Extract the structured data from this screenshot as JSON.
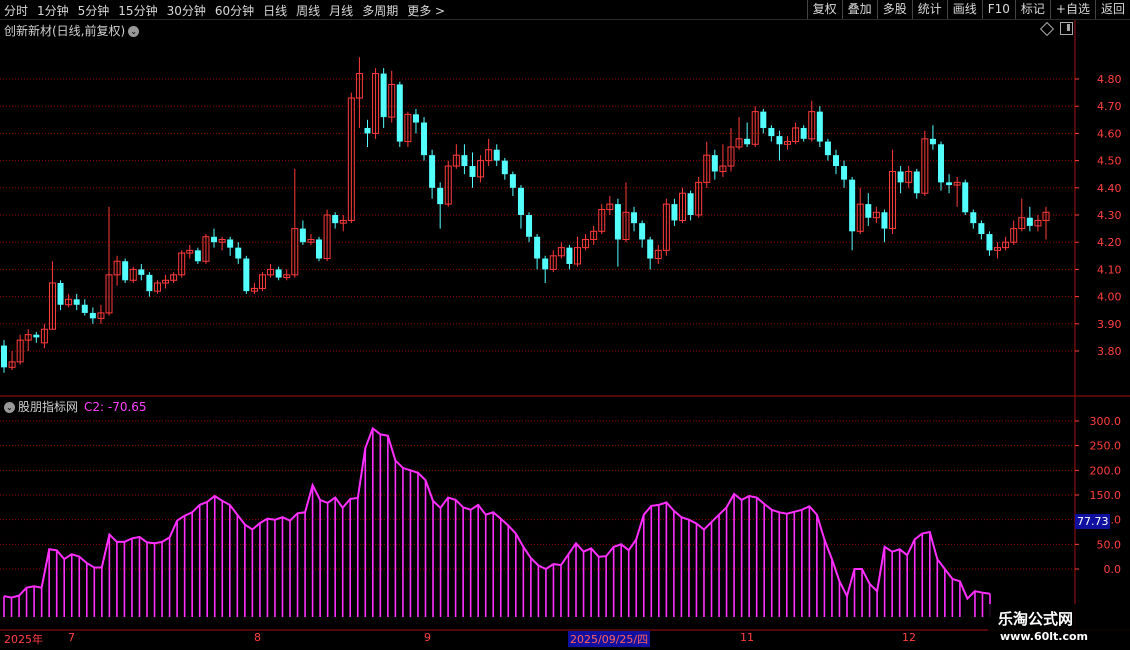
{
  "toolbar": {
    "left_items": [
      "分时",
      "1分钟",
      "5分钟",
      "15分钟",
      "30分钟",
      "60分钟",
      "日线",
      "周线",
      "月线",
      "多周期",
      "更多 >"
    ],
    "right_items": [
      "复权",
      "叠加",
      "多股",
      "统计",
      "画线",
      "F10",
      "标记",
      "+自选",
      "返回"
    ]
  },
  "stock": {
    "title": "创新新材(日线,前复权)"
  },
  "indicator": {
    "name": "股朋指标网",
    "c2_text": "C2: -70.65",
    "current_value": "77.73"
  },
  "watermark": {
    "line1": "乐淘公式网",
    "line2": "www.60lt.com"
  },
  "colors": {
    "up": "#ff3b3b",
    "down": "#54ffff",
    "indicator": "#ff30ff",
    "grid": "#8b0000",
    "axis": "#ff4040"
  },
  "x_axis_labels": [
    "2025年",
    "7",
    "8",
    "9",
    "2025/09/25/四",
    "11",
    "12"
  ],
  "chart_data": [
    {
      "type": "candlestick",
      "title": "创新新材(日线,前复权)",
      "y_ticks": [
        3.8,
        3.9,
        4.0,
        4.1,
        4.2,
        4.3,
        4.4,
        4.5,
        4.6,
        4.7,
        4.8
      ],
      "ylim": [
        3.7,
        4.9
      ],
      "candles": [
        [
          3.82,
          3.74,
          3.84,
          3.72
        ],
        [
          3.74,
          3.76,
          3.8,
          3.73
        ],
        [
          3.76,
          3.84,
          3.86,
          3.75
        ],
        [
          3.84,
          3.86,
          3.88,
          3.8
        ],
        [
          3.86,
          3.85,
          3.87,
          3.83
        ],
        [
          3.83,
          3.88,
          3.9,
          3.81
        ],
        [
          3.88,
          4.05,
          4.13,
          3.88
        ],
        [
          4.05,
          3.97,
          4.06,
          3.95
        ],
        [
          3.97,
          3.99,
          4.01,
          3.96
        ],
        [
          3.99,
          3.97,
          4.01,
          3.95
        ],
        [
          3.97,
          3.94,
          3.99,
          3.93
        ],
        [
          3.94,
          3.92,
          3.96,
          3.9
        ],
        [
          3.92,
          3.94,
          3.97,
          3.9
        ],
        [
          3.94,
          4.08,
          4.33,
          3.93
        ],
        [
          4.08,
          4.13,
          4.15,
          4.04
        ],
        [
          4.13,
          4.06,
          4.14,
          4.05
        ],
        [
          4.06,
          4.1,
          4.11,
          4.05
        ],
        [
          4.1,
          4.08,
          4.12,
          4.06
        ],
        [
          4.08,
          4.02,
          4.09,
          4.0
        ],
        [
          4.02,
          4.05,
          4.06,
          4.01
        ],
        [
          4.05,
          4.06,
          4.08,
          4.03
        ],
        [
          4.06,
          4.08,
          4.09,
          4.05
        ],
        [
          4.08,
          4.16,
          4.17,
          4.07
        ],
        [
          4.16,
          4.17,
          4.19,
          4.14
        ],
        [
          4.17,
          4.13,
          4.18,
          4.12
        ],
        [
          4.13,
          4.22,
          4.23,
          4.12
        ],
        [
          4.22,
          4.2,
          4.25,
          4.18
        ],
        [
          4.2,
          4.21,
          4.22,
          4.17
        ],
        [
          4.21,
          4.18,
          4.22,
          4.15
        ],
        [
          4.18,
          4.14,
          4.2,
          4.12
        ],
        [
          4.14,
          4.02,
          4.15,
          4.01
        ],
        [
          4.02,
          4.03,
          4.05,
          4.01
        ],
        [
          4.03,
          4.08,
          4.09,
          4.02
        ],
        [
          4.08,
          4.1,
          4.12,
          4.07
        ],
        [
          4.1,
          4.07,
          4.11,
          4.06
        ],
        [
          4.07,
          4.08,
          4.1,
          4.06
        ],
        [
          4.08,
          4.25,
          4.47,
          4.07
        ],
        [
          4.25,
          4.2,
          4.28,
          4.19
        ],
        [
          4.2,
          4.21,
          4.23,
          4.19
        ],
        [
          4.21,
          4.14,
          4.22,
          4.13
        ],
        [
          4.14,
          4.3,
          4.32,
          4.13
        ],
        [
          4.3,
          4.27,
          4.31,
          4.25
        ],
        [
          4.27,
          4.28,
          4.3,
          4.24
        ],
        [
          4.28,
          4.73,
          4.75,
          4.27
        ],
        [
          4.73,
          4.82,
          4.88,
          4.62
        ],
        [
          4.62,
          4.6,
          4.65,
          4.55
        ],
        [
          4.6,
          4.82,
          4.84,
          4.58
        ],
        [
          4.82,
          4.66,
          4.84,
          4.62
        ],
        [
          4.66,
          4.78,
          4.83,
          4.64
        ],
        [
          4.78,
          4.57,
          4.79,
          4.55
        ],
        [
          4.57,
          4.67,
          4.68,
          4.55
        ],
        [
          4.67,
          4.64,
          4.69,
          4.6
        ],
        [
          4.64,
          4.52,
          4.66,
          4.5
        ],
        [
          4.52,
          4.4,
          4.54,
          4.36
        ],
        [
          4.4,
          4.34,
          4.42,
          4.25
        ],
        [
          4.34,
          4.48,
          4.5,
          4.33
        ],
        [
          4.48,
          4.52,
          4.56,
          4.47
        ],
        [
          4.52,
          4.48,
          4.56,
          4.45
        ],
        [
          4.48,
          4.44,
          4.53,
          4.4
        ],
        [
          4.44,
          4.5,
          4.52,
          4.42
        ],
        [
          4.5,
          4.54,
          4.58,
          4.48
        ],
        [
          4.54,
          4.5,
          4.56,
          4.48
        ],
        [
          4.5,
          4.45,
          4.51,
          4.43
        ],
        [
          4.45,
          4.4,
          4.46,
          4.37
        ],
        [
          4.4,
          4.3,
          4.41,
          4.25
        ],
        [
          4.3,
          4.22,
          4.31,
          4.2
        ],
        [
          4.22,
          4.14,
          4.23,
          4.1
        ],
        [
          4.14,
          4.1,
          4.15,
          4.05
        ],
        [
          4.1,
          4.15,
          4.17,
          4.09
        ],
        [
          4.15,
          4.18,
          4.2,
          4.14
        ],
        [
          4.18,
          4.12,
          4.19,
          4.1
        ],
        [
          4.12,
          4.18,
          4.22,
          4.11
        ],
        [
          4.18,
          4.21,
          4.23,
          4.17
        ],
        [
          4.21,
          4.24,
          4.26,
          4.19
        ],
        [
          4.24,
          4.32,
          4.34,
          4.23
        ],
        [
          4.32,
          4.34,
          4.37,
          4.3
        ],
        [
          4.34,
          4.21,
          4.36,
          4.11
        ],
        [
          4.21,
          4.31,
          4.42,
          4.2
        ],
        [
          4.31,
          4.27,
          4.33,
          4.24
        ],
        [
          4.27,
          4.21,
          4.28,
          4.18
        ],
        [
          4.21,
          4.14,
          4.22,
          4.1
        ],
        [
          4.14,
          4.17,
          4.19,
          4.12
        ],
        [
          4.17,
          4.34,
          4.36,
          4.15
        ],
        [
          4.34,
          4.28,
          4.36,
          4.26
        ],
        [
          4.28,
          4.38,
          4.4,
          4.27
        ],
        [
          4.38,
          4.3,
          4.39,
          4.28
        ],
        [
          4.3,
          4.42,
          4.44,
          4.29
        ],
        [
          4.42,
          4.52,
          4.57,
          4.4
        ],
        [
          4.52,
          4.46,
          4.54,
          4.43
        ],
        [
          4.46,
          4.48,
          4.56,
          4.44
        ],
        [
          4.48,
          4.55,
          4.62,
          4.46
        ],
        [
          4.55,
          4.58,
          4.66,
          4.54
        ],
        [
          4.58,
          4.56,
          4.64,
          4.55
        ],
        [
          4.56,
          4.68,
          4.7,
          4.55
        ],
        [
          4.68,
          4.62,
          4.69,
          4.6
        ],
        [
          4.62,
          4.59,
          4.63,
          4.57
        ],
        [
          4.59,
          4.56,
          4.61,
          4.5
        ],
        [
          4.56,
          4.57,
          4.59,
          4.54
        ],
        [
          4.57,
          4.62,
          4.64,
          4.56
        ],
        [
          4.62,
          4.58,
          4.63,
          4.57
        ],
        [
          4.58,
          4.68,
          4.72,
          4.57
        ],
        [
          4.68,
          4.57,
          4.7,
          4.55
        ],
        [
          4.57,
          4.52,
          4.58,
          4.5
        ],
        [
          4.52,
          4.48,
          4.54,
          4.45
        ],
        [
          4.48,
          4.43,
          4.5,
          4.4
        ],
        [
          4.43,
          4.24,
          4.44,
          4.17
        ],
        [
          4.24,
          4.34,
          4.4,
          4.23
        ],
        [
          4.34,
          4.29,
          4.38,
          4.26
        ],
        [
          4.29,
          4.31,
          4.33,
          4.27
        ],
        [
          4.31,
          4.25,
          4.32,
          4.2
        ],
        [
          4.25,
          4.46,
          4.54,
          4.23
        ],
        [
          4.46,
          4.42,
          4.48,
          4.38
        ],
        [
          4.42,
          4.46,
          4.48,
          4.4
        ],
        [
          4.46,
          4.38,
          4.47,
          4.36
        ],
        [
          4.38,
          4.58,
          4.61,
          4.37
        ],
        [
          4.58,
          4.56,
          4.63,
          4.54
        ],
        [
          4.56,
          4.42,
          4.57,
          4.39
        ],
        [
          4.42,
          4.41,
          4.45,
          4.38
        ],
        [
          4.41,
          4.42,
          4.44,
          4.33
        ],
        [
          4.42,
          4.31,
          4.43,
          4.3
        ],
        [
          4.31,
          4.27,
          4.32,
          4.25
        ],
        [
          4.27,
          4.23,
          4.28,
          4.21
        ],
        [
          4.23,
          4.17,
          4.24,
          4.15
        ],
        [
          4.17,
          4.18,
          4.2,
          4.14
        ],
        [
          4.18,
          4.2,
          4.22,
          4.17
        ],
        [
          4.2,
          4.25,
          4.28,
          4.19
        ],
        [
          4.25,
          4.29,
          4.36,
          4.24
        ],
        [
          4.29,
          4.26,
          4.33,
          4.24
        ],
        [
          4.26,
          4.28,
          4.3,
          4.24
        ],
        [
          4.28,
          4.31,
          4.33,
          4.21
        ]
      ]
    },
    {
      "type": "bar",
      "title": "股朋指标网",
      "y_ticks": [
        0,
        50,
        100,
        150,
        200,
        250,
        300
      ],
      "ylim": [
        -60,
        330
      ],
      "values": [
        -55,
        -58,
        -54,
        -38,
        -35,
        -38,
        40,
        38,
        20,
        30,
        25,
        12,
        3,
        3,
        70,
        55,
        55,
        62,
        65,
        54,
        52,
        55,
        64,
        98,
        108,
        115,
        130,
        136,
        148,
        138,
        130,
        110,
        90,
        80,
        93,
        102,
        100,
        105,
        98,
        113,
        115,
        170,
        140,
        134,
        145,
        124,
        142,
        144,
        245,
        285,
        273,
        270,
        220,
        205,
        200,
        195,
        180,
        138,
        124,
        145,
        140,
        125,
        120,
        130,
        110,
        115,
        102,
        88,
        72,
        45,
        22,
        7,
        0,
        10,
        8,
        30,
        52,
        35,
        42,
        25,
        26,
        45,
        50,
        38,
        60,
        110,
        128,
        130,
        135,
        118,
        105,
        100,
        92,
        80,
        95,
        110,
        125,
        152,
        140,
        148,
        145,
        132,
        120,
        115,
        112,
        116,
        120,
        127,
        110,
        60,
        20,
        -25,
        -55,
        0,
        0,
        -30,
        -45,
        45,
        35,
        40,
        28,
        60,
        72,
        75,
        20,
        0,
        -20,
        -25,
        -60,
        -45,
        -48,
        -50
      ]
    }
  ]
}
